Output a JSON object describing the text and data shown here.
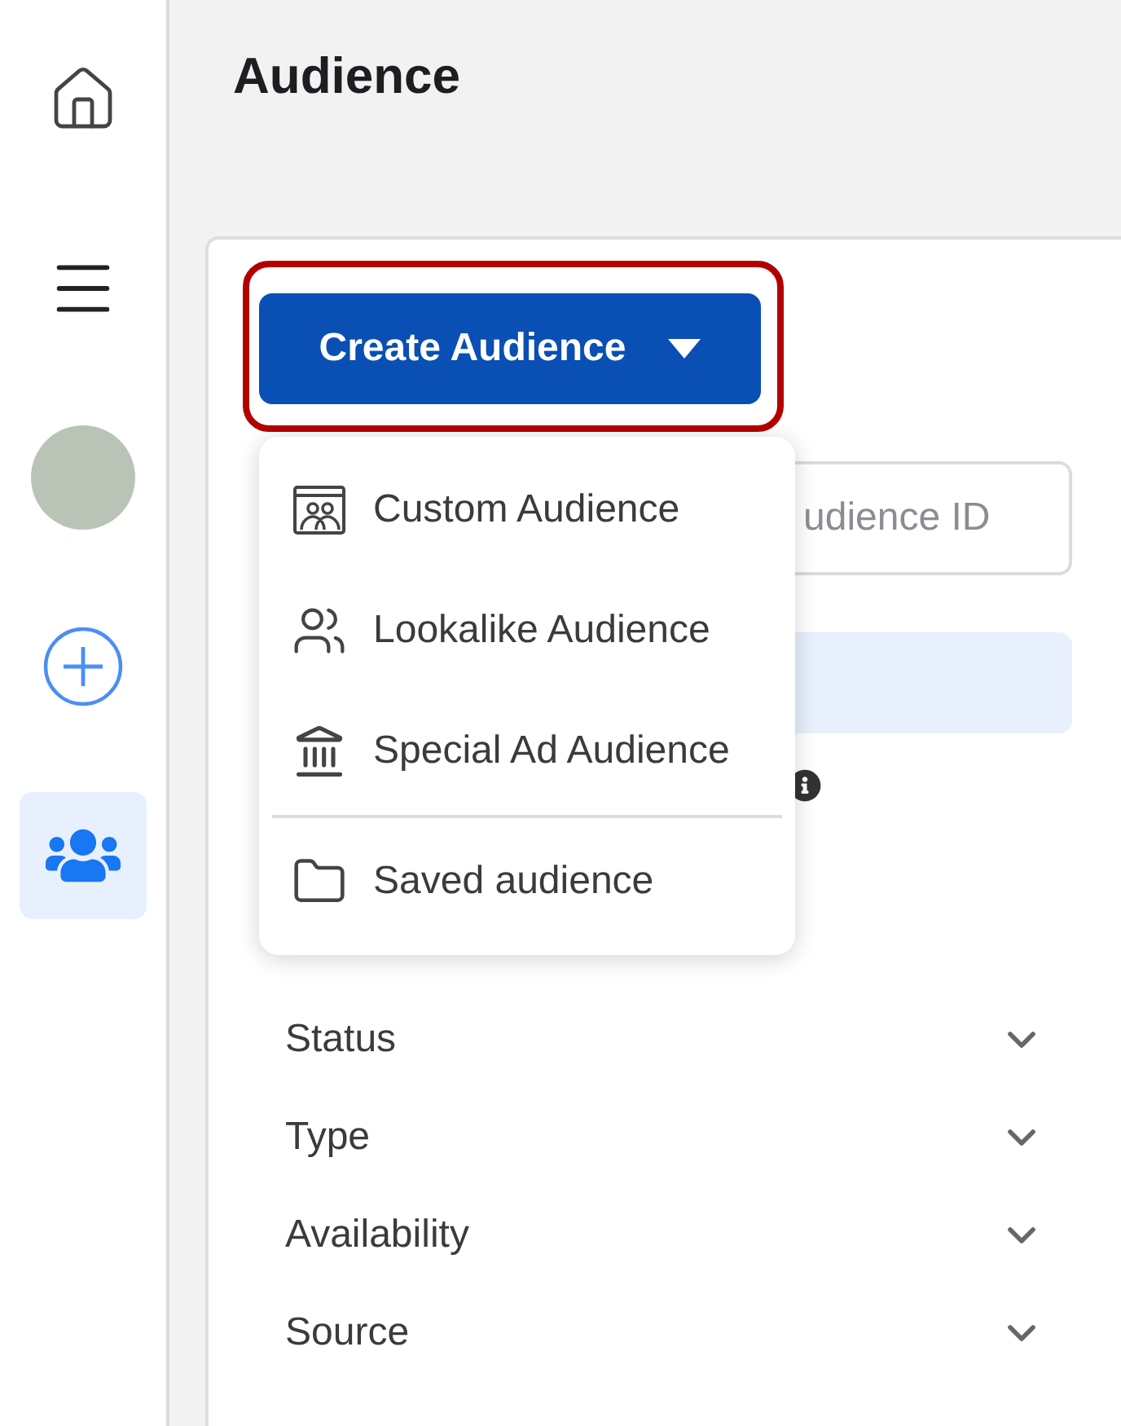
{
  "sidebar": {
    "items": [
      {
        "kind": "home",
        "selected": false
      },
      {
        "kind": "menu",
        "selected": false
      },
      {
        "kind": "avatar",
        "selected": false
      },
      {
        "kind": "create",
        "selected": false
      },
      {
        "kind": "audiences",
        "selected": true
      }
    ]
  },
  "page": {
    "title": "Audience"
  },
  "create_button": {
    "label": "Create Audience",
    "highlighted": true
  },
  "create_menu": {
    "items": [
      {
        "kind": "custom",
        "label": "Custom Audience",
        "separated": false
      },
      {
        "kind": "lookalike",
        "label": "Lookalike Audience",
        "separated": false
      },
      {
        "kind": "special",
        "label": "Special Ad Audience",
        "separated": false
      },
      {
        "kind": "saved",
        "label": "Saved audience",
        "separated": true
      }
    ]
  },
  "search": {
    "placeholder": "udience ID"
  },
  "filters": [
    {
      "label": "Status",
      "expanded": false
    },
    {
      "label": "Type",
      "expanded": false
    },
    {
      "label": "Availability",
      "expanded": false
    },
    {
      "label": "Source",
      "expanded": false
    }
  ]
}
